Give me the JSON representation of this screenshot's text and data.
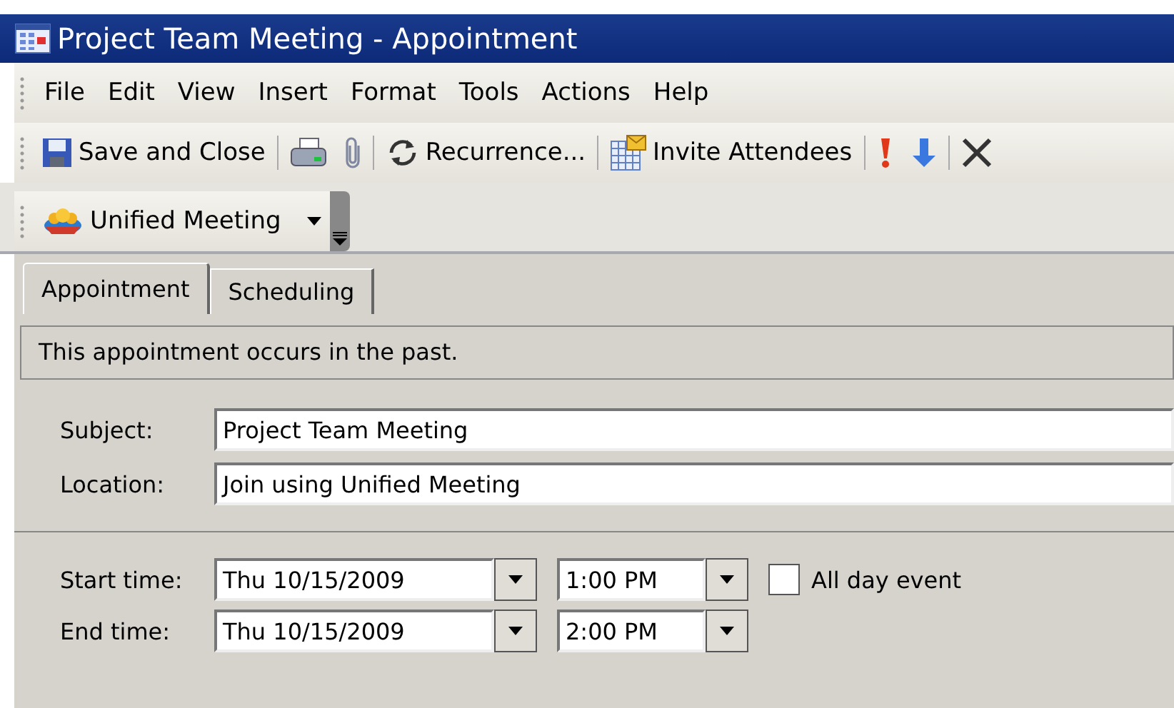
{
  "window": {
    "title": "Project Team Meeting - Appointment"
  },
  "menu": [
    "File",
    "Edit",
    "View",
    "Insert",
    "Format",
    "Tools",
    "Actions",
    "Help"
  ],
  "toolbar": [
    {
      "kind": "save",
      "label": "Save and Close"
    },
    {
      "kind": "sep"
    },
    {
      "kind": "print"
    },
    {
      "kind": "attach"
    },
    {
      "kind": "sep"
    },
    {
      "kind": "recurrence",
      "label": "Recurrence..."
    },
    {
      "kind": "sep"
    },
    {
      "kind": "invite",
      "label": "Invite Attendees"
    },
    {
      "kind": "sep"
    },
    {
      "kind": "high"
    },
    {
      "kind": "low"
    },
    {
      "kind": "sep"
    },
    {
      "kind": "delete"
    }
  ],
  "toolbar2": {
    "label": "Unified Meeting"
  },
  "tabs": [
    {
      "label": "Appointment",
      "selected": true
    },
    {
      "label": "Scheduling",
      "selected": false
    }
  ],
  "info": "This appointment occurs in the past.",
  "fields": [
    {
      "label": "Subject:",
      "value": "Project Team Meeting"
    },
    {
      "label": "Location:",
      "value": "Join using Unified Meeting"
    }
  ],
  "times": [
    {
      "label": "Start time:",
      "date": "Thu 10/15/2009",
      "time": "1:00 PM"
    },
    {
      "label": "End time:",
      "date": "Thu 10/15/2009",
      "time": "2:00 PM"
    }
  ],
  "all_day": {
    "label": "All day event",
    "checked": false
  }
}
